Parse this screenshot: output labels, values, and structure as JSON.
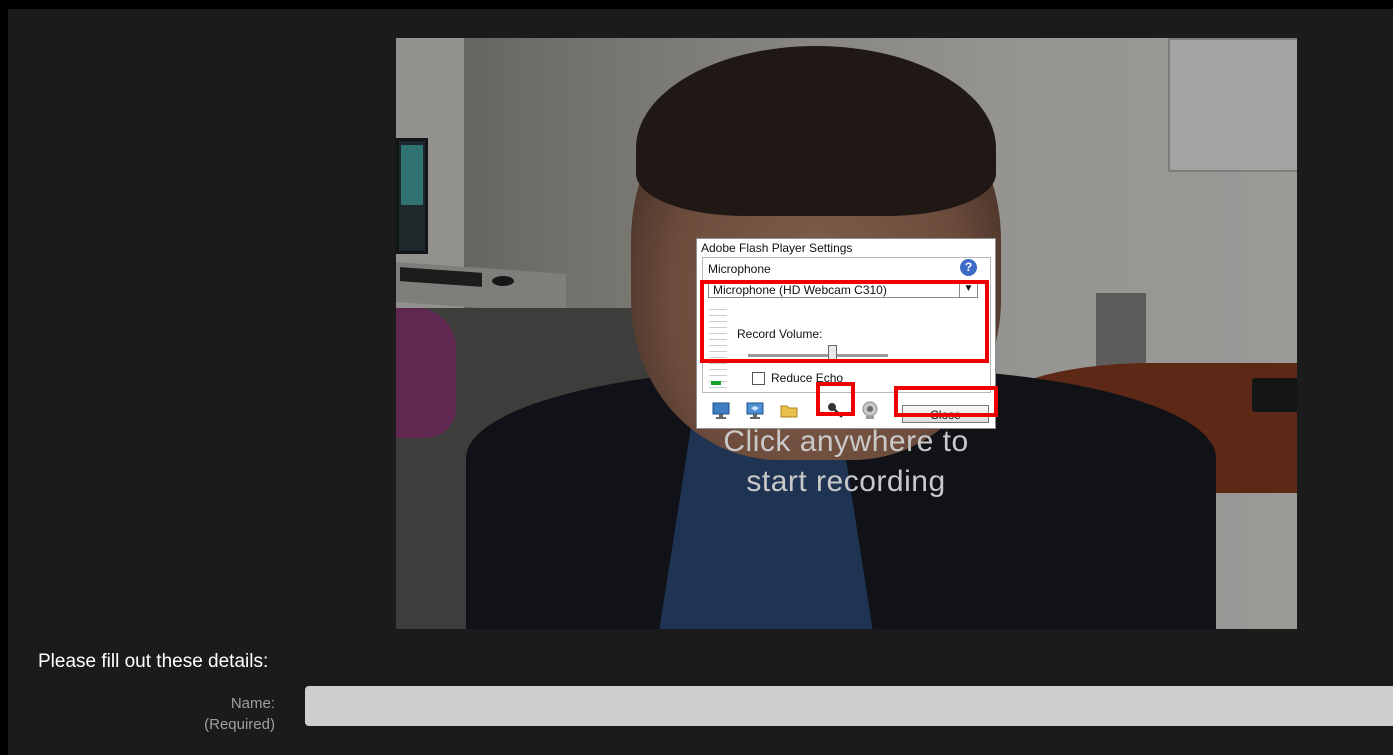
{
  "webcam": {
    "overlay_text_line1": "Click anywhere to",
    "overlay_text_line2": "start recording"
  },
  "flash_settings": {
    "title": "Adobe Flash Player Settings",
    "section": "Microphone",
    "help_icon": "question-icon",
    "microphone_select": {
      "selected": "Microphone (HD Webcam C310)",
      "arrow_icon": "dropdown-arrow-icon"
    },
    "record_volume_label": "Record Volume:",
    "record_volume_level": 0.6,
    "reduce_echo_label": "Reduce Echo",
    "reduce_echo_checked": false,
    "tabs": [
      {
        "name": "display",
        "icon": "monitor-icon"
      },
      {
        "name": "privacy",
        "icon": "privacy-monitor-icon"
      },
      {
        "name": "local-storage",
        "icon": "folder-icon"
      },
      {
        "name": "microphone",
        "icon": "microphone-icon",
        "active": true
      },
      {
        "name": "camera",
        "icon": "webcam-icon"
      }
    ],
    "close_label": "Close",
    "highlight_color": "#e00000"
  },
  "form": {
    "heading": "Please fill out these details:",
    "name_label": "Name:",
    "name_required": "(Required)",
    "name_value": ""
  }
}
